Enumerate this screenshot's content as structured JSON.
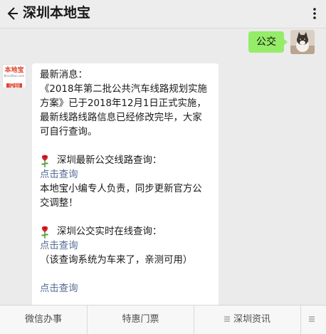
{
  "header": {
    "title": "深圳本地宝",
    "back_icon": "arrow-left-icon",
    "more_icon": "vertical-dots-icon"
  },
  "user_message": {
    "text": "公交",
    "bubble_color": "#95ec69"
  },
  "bot_avatar": {
    "logo_text": "本地宝",
    "logo_url": "BendiBao.com",
    "tag": "深圳",
    "brand_color": "#e0462d"
  },
  "bot_message": {
    "intro": "最新消息：",
    "body_lines": [
      "《2018年第二批公共汽车线路规划实施",
      "方案》已于2018年12月1日正式实施，",
      "最新线路线路信息已经修改完毕，大家",
      "可自行查询。"
    ],
    "section1": {
      "icon": "rose-icon",
      "title": "深圳最新公交线路查询：",
      "link": "点击查询",
      "note_lines": [
        "本地宝小编专人负责，同步更新官方公",
        "交调整！"
      ]
    },
    "section2": {
      "icon": "rose-icon",
      "title": "深圳公交实时在线查询：",
      "link": "点击查询",
      "note": "（该查询系统为车来了，亲测可用）"
    },
    "section3": {
      "link": "点击查询"
    },
    "link_color": "#576b95"
  },
  "menu": {
    "items": [
      {
        "label": "微信办事"
      },
      {
        "label": "特惠门票"
      },
      {
        "label": "深圳资讯",
        "icon": "list-icon"
      },
      {
        "label": "",
        "icon": "list-icon"
      }
    ]
  }
}
